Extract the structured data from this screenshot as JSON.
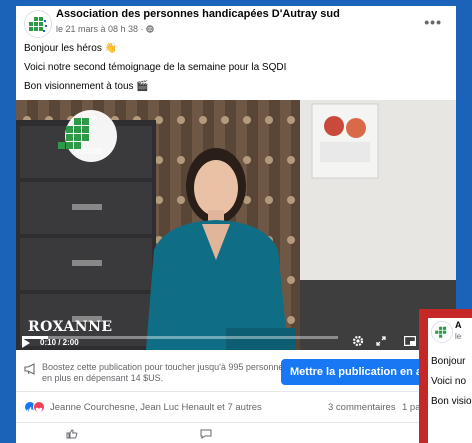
{
  "post": {
    "page_name": "Association des personnes handicapées D'Autray sud",
    "timestamp": "le 21 mars à 08 h 38 · ",
    "body_lines": [
      "Bonjour les héros 👋",
      "Voici notre second témoignage de la semaine pour la SQDI",
      "Bon visionnement à tous 🎬"
    ]
  },
  "video": {
    "caption_name": "ROXANNE",
    "time": "0:10 / 2:00",
    "progress_fraction": 0.083
  },
  "boost": {
    "text": "Boostez cette publication pour toucher jusqu'à 995 personnes en plus en dépensant 14 $US.",
    "button_label": "Mettre la publication en avant"
  },
  "reactions": {
    "names": "Jeanne Courchesne, Jean Luc Henault et 7 autres",
    "comments": "3 commentaires",
    "shares": "1 pa"
  },
  "overlay_post": {
    "name": "A",
    "meta": "le",
    "lines": [
      "Bonjour",
      "Voici no",
      "Bon visio"
    ]
  },
  "colors": {
    "frame": "#1a63b8",
    "accent": "#1877f2",
    "overlay_frame": "#c62828"
  },
  "icons": {
    "more": "more-dots-icon",
    "globe": "globe-icon",
    "play": "play-icon",
    "volume": "volume-icon",
    "settings": "settings-gear-icon",
    "fullscreen": "fullscreen-icon",
    "pip": "picture-in-picture-icon",
    "boost": "megaphone-icon"
  }
}
